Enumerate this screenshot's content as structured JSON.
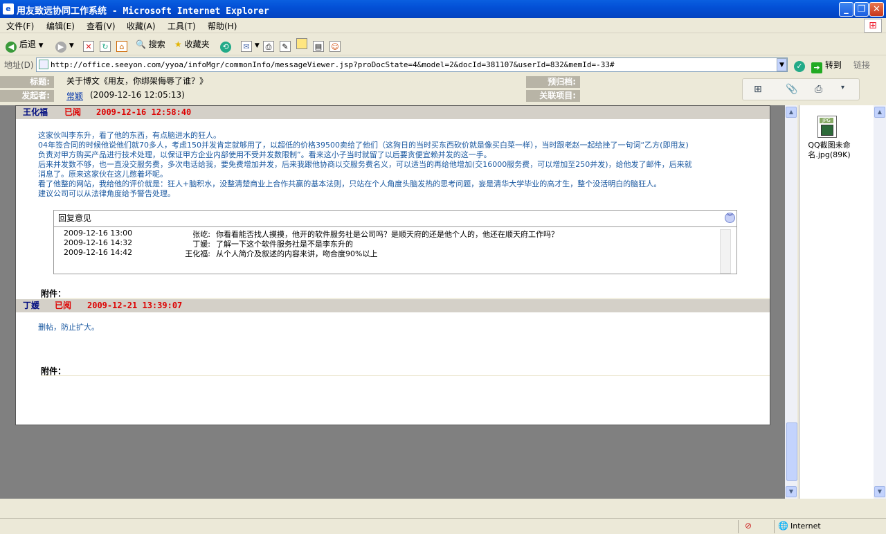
{
  "window": {
    "title": "用友致远协同工作系统 - Microsoft Internet Explorer",
    "app_icon": "ie-icon",
    "min": "_",
    "max": "❐",
    "close": "✕"
  },
  "menu": [
    {
      "label": "文件(F)"
    },
    {
      "label": "编辑(E)"
    },
    {
      "label": "查看(V)"
    },
    {
      "label": "收藏(A)"
    },
    {
      "label": "工具(T)"
    },
    {
      "label": "帮助(H)"
    }
  ],
  "toolbar": {
    "back": "后退",
    "search": "搜索",
    "favorites": "收藏夹"
  },
  "address": {
    "label": "地址(D)",
    "url": "http://office.seeyon.com/yyoa/infoMgr/commonInfo/messageViewer.jsp?proDocState=4&model=2&docId=381107&userId=832&memId=-33#",
    "go": "转到",
    "links": "链接"
  },
  "header": {
    "subject_label": "标题:",
    "subject": "关于博文《用友，你绑架侮辱了谁？》",
    "initiator_label": "发起者:",
    "initiator": "常颖",
    "initiated_time": "(2009-12-16 12:05:13)",
    "archive_label": "预归档:",
    "project_label": "关联项目:"
  },
  "posts": [
    {
      "name": "王化福",
      "status": "已阅",
      "time": "2009-12-16 12:58:40",
      "lines": [
        "这家伙叫李东升，看了他的东西，有点脑进水的狂人。",
        "04年签合同的时候他说他们就70多人，考虑150并发肯定就够用了，以超低的价格39500卖给了他们（这狗日的当时买东西砍价就是像买白菜一样），当时跟老赵一起给挫了一句词“乙方(即用友)",
        "负责对甲方购买产品进行技术处理，以保证甲方企业内部使用不受并发数限制”。看来这小子当时就留了以后要贪便宜赖并发的这一手。",
        "后来并发数不够，也一直没交服务费，多次电话给我，要免费增加并发，后来我跟他协商以交服务费名义，可以适当的再给他增加(交16000服务费，可以增加至250并发)，给他发了邮件，后来就",
        "消息了。原来这家伙在这儿憋着坏呢。",
        "看了他整的网站，我给他的评价就是：狂人+脑积水，没整清楚商业上合作共赢的基本法则，只站在个人角度头脑发热的思考问题，妄是清华大学毕业的高才生，整个没活明白的脑狂人。",
        "建议公司可以从法律角度给予警告处理。"
      ],
      "attach_label": "附件："
    },
    {
      "name": "丁媛",
      "status": "已阅",
      "time": "2009-12-21 13:39:07",
      "lines": [
        "删帖，防止扩大。"
      ],
      "attach_label": "附件："
    }
  ],
  "reply": {
    "title": "回复意见",
    "rows": [
      {
        "time": "2009-12-16 13:00",
        "name": "张屹:",
        "text": "你看看能否找人摸摸，他开的软件服务社是公司吗？是顺天府的还是他个人的，他还在顺天府工作吗？"
      },
      {
        "time": "2009-12-16 14:32",
        "name": "丁媛:",
        "text": "了解一下这个软件服务社是不是李东升的"
      },
      {
        "time": "2009-12-16 14:42",
        "name": "王化福:",
        "text": "从个人简介及叙述的内容来讲，吻合度90%以上"
      }
    ]
  },
  "attachment": {
    "file": "QQ截图未命名.jpg(89K)",
    "file_line1": "QQ截图未命",
    "file_line2": "名.jpg(89K)",
    "badge": "JPG"
  },
  "status": {
    "zone": "Internet"
  }
}
